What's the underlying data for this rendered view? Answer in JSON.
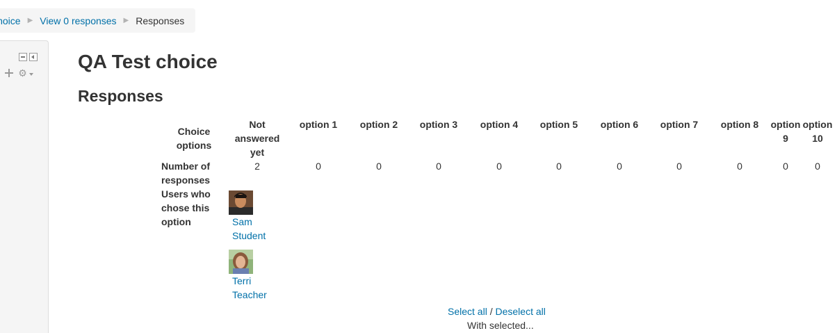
{
  "breadcrumb": {
    "items": [
      "Choice",
      "View 0 responses"
    ],
    "current": "Responses"
  },
  "page": {
    "title": "QA Test choice",
    "section": "Responses"
  },
  "table": {
    "row_labels": {
      "options": "Choice options",
      "count": "Number of responses",
      "users": "Users who chose this option"
    },
    "columns": [
      {
        "label": "Not answered yet",
        "count": "2"
      },
      {
        "label": "option 1",
        "count": "0"
      },
      {
        "label": "option 2",
        "count": "0"
      },
      {
        "label": "option 3",
        "count": "0"
      },
      {
        "label": "option 4",
        "count": "0"
      },
      {
        "label": "option 5",
        "count": "0"
      },
      {
        "label": "option 6",
        "count": "0"
      },
      {
        "label": "option 7",
        "count": "0"
      },
      {
        "label": "option 8",
        "count": "0"
      },
      {
        "label": "option 9",
        "count": "0"
      },
      {
        "label": "option 10",
        "count": "0"
      }
    ],
    "users": [
      {
        "first": "Sam",
        "last": "Student"
      },
      {
        "first": "Terri",
        "last": "Teacher"
      }
    ]
  },
  "actions": {
    "select_all": "Select all",
    "separator": "/",
    "deselect_all": "Deselect all",
    "with_selected": "With selected..."
  }
}
